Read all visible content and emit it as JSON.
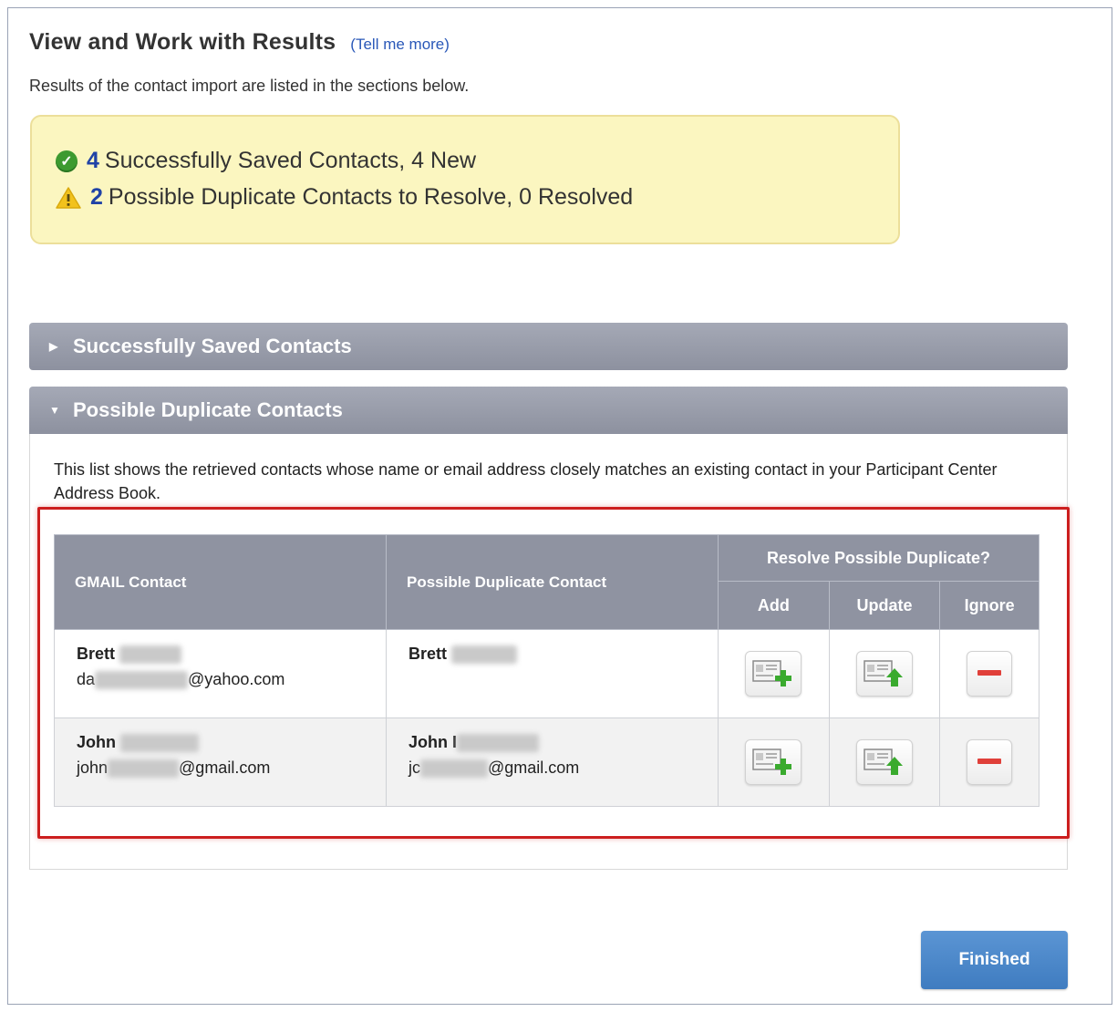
{
  "header": {
    "title": "View and Work with Results",
    "tell_more": "(Tell me more)",
    "subtitle": "Results of the contact import are listed in the sections below."
  },
  "summary": {
    "saved": {
      "icon": "check-circle-icon",
      "count": "4",
      "text": "Successfully Saved Contacts, 4 New",
      "color": "#3d9a30"
    },
    "duplicates": {
      "icon": "warning-icon",
      "count": "2",
      "text": "Possible Duplicate Contacts to Resolve, 0 Resolved",
      "color": "#f2c21d"
    }
  },
  "sections": {
    "saved": {
      "label": "Successfully Saved Contacts",
      "expanded": false
    },
    "duplicates": {
      "label": "Possible Duplicate Contacts",
      "expanded": true,
      "description": "This list shows the retrieved contacts whose name or email address closely matches an existing contact in your Participant Center Address Book."
    }
  },
  "table": {
    "col_source": "GMAIL Contact",
    "col_match": "Possible Duplicate Contact",
    "col_group": "Resolve Possible Duplicate?",
    "col_add": "Add",
    "col_update": "Update",
    "col_ignore": "Ignore",
    "rows": [
      {
        "source_name": "Brett",
        "source_email_prefix": "da",
        "source_email_suffix": "@yahoo.com",
        "match_name": "Brett",
        "match_email_prefix": "",
        "match_email_suffix": ""
      },
      {
        "source_name": "John",
        "source_email_prefix": "john",
        "source_email_suffix": "@gmail.com",
        "match_name": "John I",
        "match_email_prefix": "jc",
        "match_email_suffix": "@gmail.com"
      }
    ]
  },
  "actions": {
    "finished_label": "Finished"
  },
  "colors": {
    "summary_bg": "#fbf6c0",
    "section_bar": "#8f93a1",
    "highlight_border": "#cc1f1f",
    "primary_button": "#4a87c9",
    "count_link": "#2043a6"
  }
}
